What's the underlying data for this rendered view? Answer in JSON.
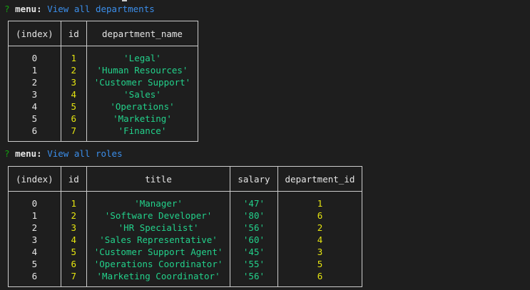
{
  "prompts": [
    {
      "q": "?",
      "key": "menu:",
      "value": "View all departments"
    },
    {
      "q": "?",
      "key": "menu:",
      "value": "View all roles"
    }
  ],
  "departments": {
    "headers": [
      "(index)",
      "id",
      "department_name"
    ],
    "rows": [
      [
        "0",
        "1",
        "'Legal'"
      ],
      [
        "1",
        "2",
        "'Human Resources'"
      ],
      [
        "2",
        "3",
        "'Customer Support'"
      ],
      [
        "3",
        "4",
        "'Sales'"
      ],
      [
        "4",
        "5",
        "'Operations'"
      ],
      [
        "5",
        "6",
        "'Marketing'"
      ],
      [
        "6",
        "7",
        "'Finance'"
      ]
    ]
  },
  "roles": {
    "headers": [
      "(index)",
      "id",
      "title",
      "salary",
      "department_id"
    ],
    "rows": [
      [
        "0",
        "1",
        "'Manager'",
        "'47'",
        "1"
      ],
      [
        "1",
        "2",
        "'Software Developer'",
        "'80'",
        "6"
      ],
      [
        "2",
        "3",
        "'HR Specialist'",
        "'56'",
        "2"
      ],
      [
        "3",
        "4",
        "'Sales Representative'",
        "'60'",
        "4"
      ],
      [
        "4",
        "5",
        "'Customer Support Agent'",
        "'45'",
        "3"
      ],
      [
        "5",
        "6",
        "'Operations Coordinator'",
        "'55'",
        "5"
      ],
      [
        "6",
        "7",
        "'Marketing Coordinator'",
        "'56'",
        "6"
      ]
    ]
  },
  "colors": {
    "background": "#1e1e1e",
    "prompt_question": "#13a10e",
    "menu_value": "#3b8eea",
    "number": "#e5e510",
    "string": "#23d18b"
  }
}
